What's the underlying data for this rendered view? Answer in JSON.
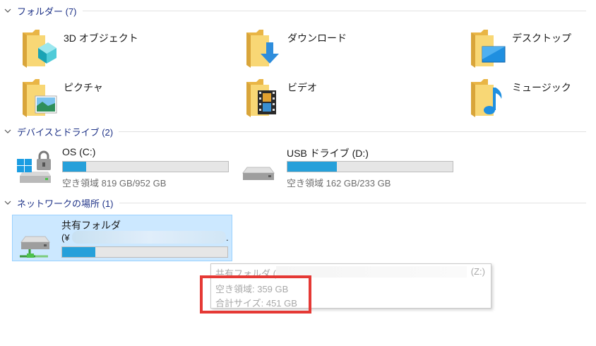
{
  "groups": {
    "folders": {
      "title": "フォルダー (7)"
    },
    "devices": {
      "title": "デバイスとドライブ (2)"
    },
    "network": {
      "title": "ネットワークの場所 (1)"
    }
  },
  "folders": [
    {
      "label": "3D オブジェクト",
      "icon": "3d-objects-folder-icon"
    },
    {
      "label": "ダウンロード",
      "icon": "downloads-folder-icon"
    },
    {
      "label": "デスクトップ",
      "icon": "desktop-folder-icon"
    },
    {
      "label": "ピクチャ",
      "icon": "pictures-folder-icon"
    },
    {
      "label": "ビデオ",
      "icon": "videos-folder-icon"
    },
    {
      "label": "ミュージック",
      "icon": "music-folder-icon"
    }
  ],
  "drives": [
    {
      "label": "OS (C:)",
      "free": "空き領域 819 GB/952 GB",
      "used_fraction": 0.14,
      "icon": "windows-drive-lock-icon"
    },
    {
      "label": "USB ドライブ (D:)",
      "free": "空き領域 162 GB/233 GB",
      "used_fraction": 0.3,
      "icon": "usb-drive-icon"
    }
  ],
  "network": {
    "label": "共有フォルダ",
    "path_start": "(¥",
    "path_end": ".",
    "used_fraction": 0.2,
    "icon": "network-drive-icon"
  },
  "tooltip": {
    "name": "共有フォルダ (",
    "drive_letter": "(Z:)",
    "free": "空き領域: 359 GB",
    "total": "合計サイズ: 451 GB"
  },
  "colors": {
    "accent": "#26a0da",
    "header_text": "#1e3287",
    "selection": "#cce8ff",
    "highlight": "#e53935"
  }
}
